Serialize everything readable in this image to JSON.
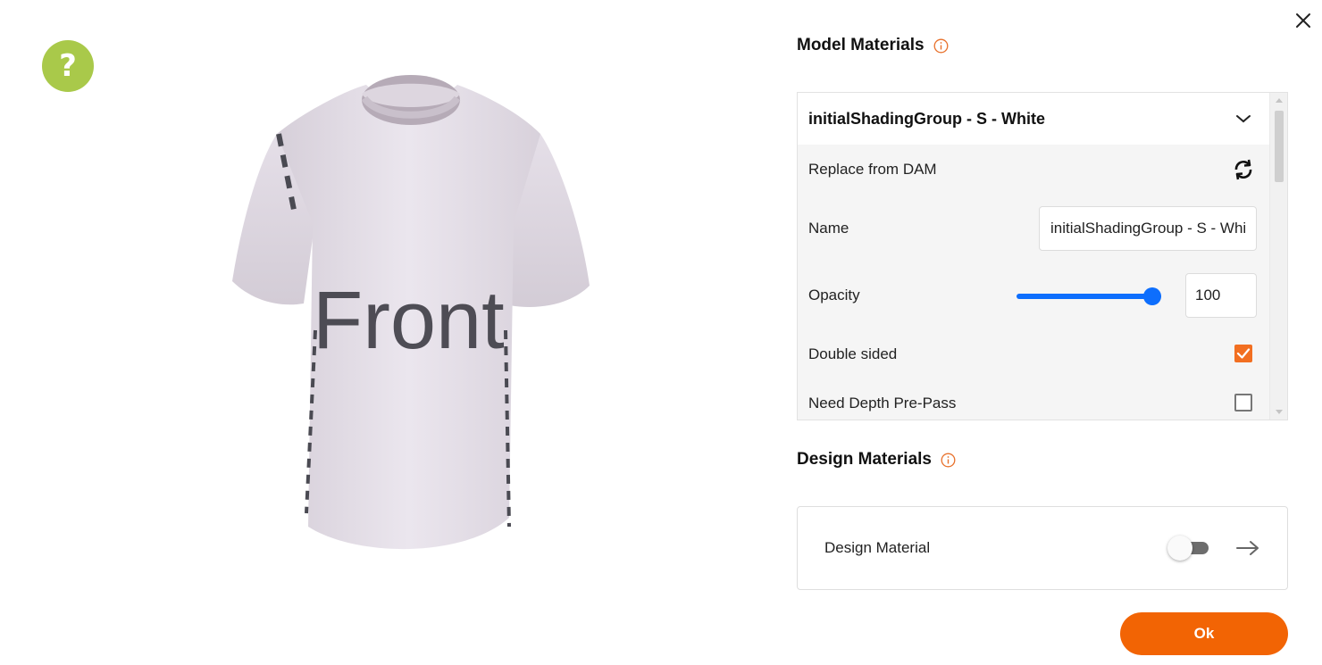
{
  "help": {
    "glyph": "?"
  },
  "preview": {
    "garment_text": "Front"
  },
  "model_materials": {
    "title": "Model Materials",
    "selected_material": "initialShadingGroup - S - White",
    "replace_label": "Replace from DAM",
    "name_label": "Name",
    "name_value": "initialShadingGroup - S - White",
    "opacity_label": "Opacity",
    "opacity_value": "100",
    "opacity_level": 1.0,
    "double_sided_label": "Double sided",
    "double_sided_checked": true,
    "depth_prepass_label": "Need Depth Pre-Pass",
    "depth_prepass_checked": false
  },
  "design_materials": {
    "title": "Design Materials",
    "item_label": "Design Material",
    "toggle_on": false
  },
  "footer": {
    "ok_label": "Ok"
  },
  "colors": {
    "accent": "#f26404",
    "checkbox": "#f26f21",
    "slider": "#0d6efd",
    "help": "#a9c94a"
  },
  "icons": [
    "help-icon",
    "close-icon",
    "info-icon",
    "chevron-down-icon",
    "refresh-icon",
    "check-icon",
    "arrow-right-icon"
  ]
}
